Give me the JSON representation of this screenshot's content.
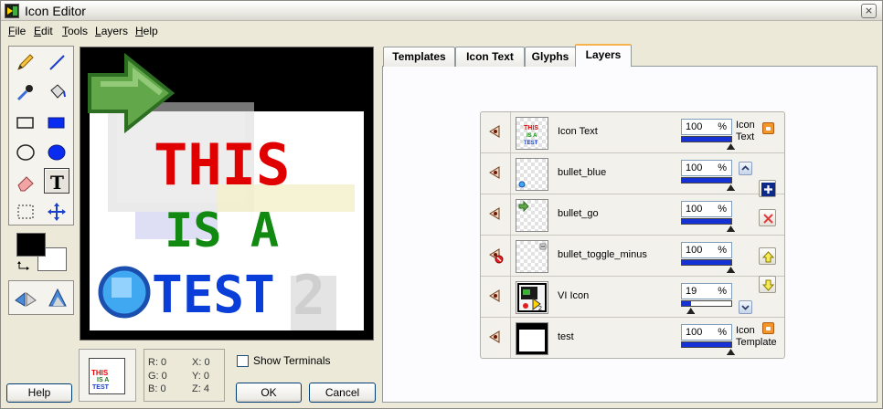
{
  "window": {
    "title": "Icon Editor",
    "close_label": "×"
  },
  "menu": [
    {
      "label": "File"
    },
    {
      "label": "Edit"
    },
    {
      "label": "Tools"
    },
    {
      "label": "Layers"
    },
    {
      "label": "Help"
    }
  ],
  "tools": [
    "pencil-icon",
    "line-icon",
    "eyedropper-icon",
    "fill-bucket-icon",
    "rectangle-icon",
    "filled-rectangle-icon",
    "ellipse-icon",
    "filled-ellipse-icon",
    "eraser-icon",
    "text-tool-icon",
    "selection-icon",
    "move-icon"
  ],
  "colors": {
    "foreground": "#000000",
    "background": "#ffffff",
    "accent_tab": "#f7b34d",
    "slider_fill": "#1532d6"
  },
  "canvas": {
    "line1": "THIS",
    "line2": "IS A",
    "line3": "TEST",
    "superscript": "2"
  },
  "preview": {
    "line1": "THIS",
    "line2": "IS A",
    "line3": "TEST"
  },
  "coords": {
    "r": "R: 0",
    "g": "G: 0",
    "b": "B: 0",
    "x": "X: 0",
    "y": "Y: 0",
    "z": "Z: 4"
  },
  "show_terminals": {
    "label": "Show Terminals",
    "checked": false
  },
  "buttons": {
    "help": "Help",
    "ok": "OK",
    "cancel": "Cancel"
  },
  "tabs": [
    {
      "label": "Templates",
      "active": false
    },
    {
      "label": "Icon Text",
      "active": false
    },
    {
      "label": "Glyphs",
      "active": false
    },
    {
      "label": "Layers",
      "active": true
    }
  ],
  "layers": [
    {
      "name": "Icon Text",
      "opacity": "100",
      "pct": "%",
      "level": 1.0,
      "visible": true,
      "lock_label_1": "Icon",
      "lock_label_2": "Text"
    },
    {
      "name": "bullet_blue",
      "opacity": "100",
      "pct": "%",
      "level": 1.0,
      "visible": true
    },
    {
      "name": "bullet_go",
      "opacity": "100",
      "pct": "%",
      "level": 1.0,
      "visible": true
    },
    {
      "name": "bullet_toggle_minus",
      "opacity": "100",
      "pct": "%",
      "level": 1.0,
      "visible": false
    },
    {
      "name": "VI Icon",
      "opacity": "19",
      "pct": "%",
      "level": 0.19,
      "visible": true
    },
    {
      "name": "test",
      "opacity": "100",
      "pct": "%",
      "level": 1.0,
      "visible": true,
      "lock_label_1": "Icon",
      "lock_label_2": "Template"
    }
  ]
}
